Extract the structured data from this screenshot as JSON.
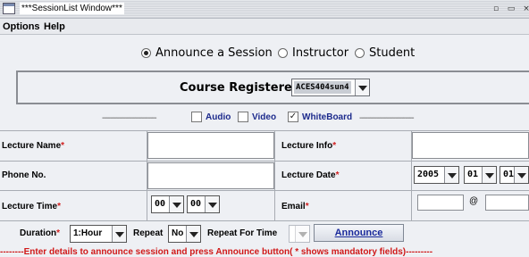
{
  "window": {
    "title": "***SessionList Window***"
  },
  "menu": {
    "items": [
      "Options",
      "Help"
    ]
  },
  "roles": {
    "options": [
      "Announce a Session",
      "Instructor",
      "Student"
    ],
    "selected": "Announce a Session"
  },
  "course": {
    "label": "Course Registered",
    "selected": "ACES404sun4"
  },
  "media": {
    "left_dashes": "--------------------------",
    "right_dashes": "--------------------------",
    "options": [
      {
        "label": "Audio",
        "checked": false
      },
      {
        "label": "Video",
        "checked": false
      },
      {
        "label": "WhiteBoard",
        "checked": true
      }
    ]
  },
  "form": {
    "lecture_name": {
      "label": "Lecture Name",
      "required": "*",
      "value": ""
    },
    "lecture_info": {
      "label": "Lecture Info",
      "required": "*",
      "value": ""
    },
    "phone": {
      "label": "Phone No.",
      "value": ""
    },
    "lecture_date": {
      "label": "Lecture Date",
      "required": "*",
      "year": "2005",
      "month": "01",
      "day": "01"
    },
    "lecture_time": {
      "label": "Lecture Time",
      "required": "*",
      "hour": "00",
      "minute": "00"
    },
    "email": {
      "label": "Email",
      "required": "*",
      "user": "",
      "at": "@",
      "domain": ""
    }
  },
  "options_row": {
    "duration_label": "Duration",
    "duration_required": "*",
    "duration_value": "1:Hour",
    "repeat_label": "Repeat",
    "repeat_value": "No",
    "repeat_time_label": "Repeat For Time",
    "repeat_time_value": "",
    "announce_label": "Announce"
  },
  "status": "--------Enter details to announce session and press Announce button( * shows mandatory fields)---------",
  "colors": {
    "required": "#d02020",
    "link_blue": "#1a2a9c",
    "status_red": "#d01818"
  }
}
